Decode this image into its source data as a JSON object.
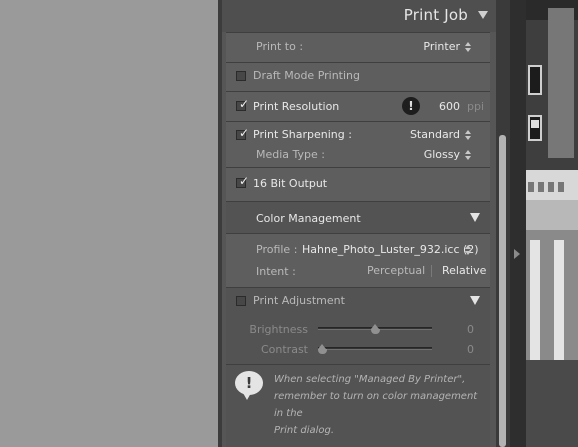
{
  "panel": {
    "title": "Print Job",
    "print_to": {
      "label": "Print to :",
      "value": "Printer"
    },
    "draft_mode": {
      "label": "Draft Mode Printing",
      "checked": false
    },
    "print_resolution": {
      "label": "Print Resolution",
      "checked": true,
      "value": "600",
      "unit": "ppi"
    },
    "print_sharpening": {
      "label": "Print Sharpening :",
      "checked": true,
      "value": "Standard"
    },
    "media_type": {
      "label": "Media Type :",
      "value": "Glossy"
    },
    "bit_output": {
      "label": "16 Bit Output",
      "checked": true
    },
    "color_management": {
      "title": "Color Management",
      "profile_label": "Profile :",
      "profile_value": "Hahne_Photo_Luster_932.icc (2)",
      "intent_label": "Intent :",
      "intent_options": [
        "Perceptual",
        "Relative"
      ],
      "intent_selected": "Relative"
    },
    "print_adjustment": {
      "label": "Print Adjustment",
      "checked": false,
      "brightness": {
        "label": "Brightness",
        "value": "0"
      },
      "contrast": {
        "label": "Contrast",
        "value": "0"
      }
    },
    "note": {
      "line1": "When selecting \"Managed By Printer\",",
      "line2": "remember to turn on color management in the",
      "line3": "Print dialog."
    }
  },
  "slider_levels": {
    "brightness": 0.5,
    "contrast": 0.0
  },
  "colors": {
    "panel_bg": "#565656",
    "canvas_bg": "#9a9a9a",
    "text_bright": "#e8e8e8"
  },
  "icons": [
    "dropdown-arrows-icon",
    "checkbox-icon",
    "warning-icon",
    "disclosure-triangle-icon",
    "info-bubble-icon",
    "collapse-arrow-icon"
  ]
}
